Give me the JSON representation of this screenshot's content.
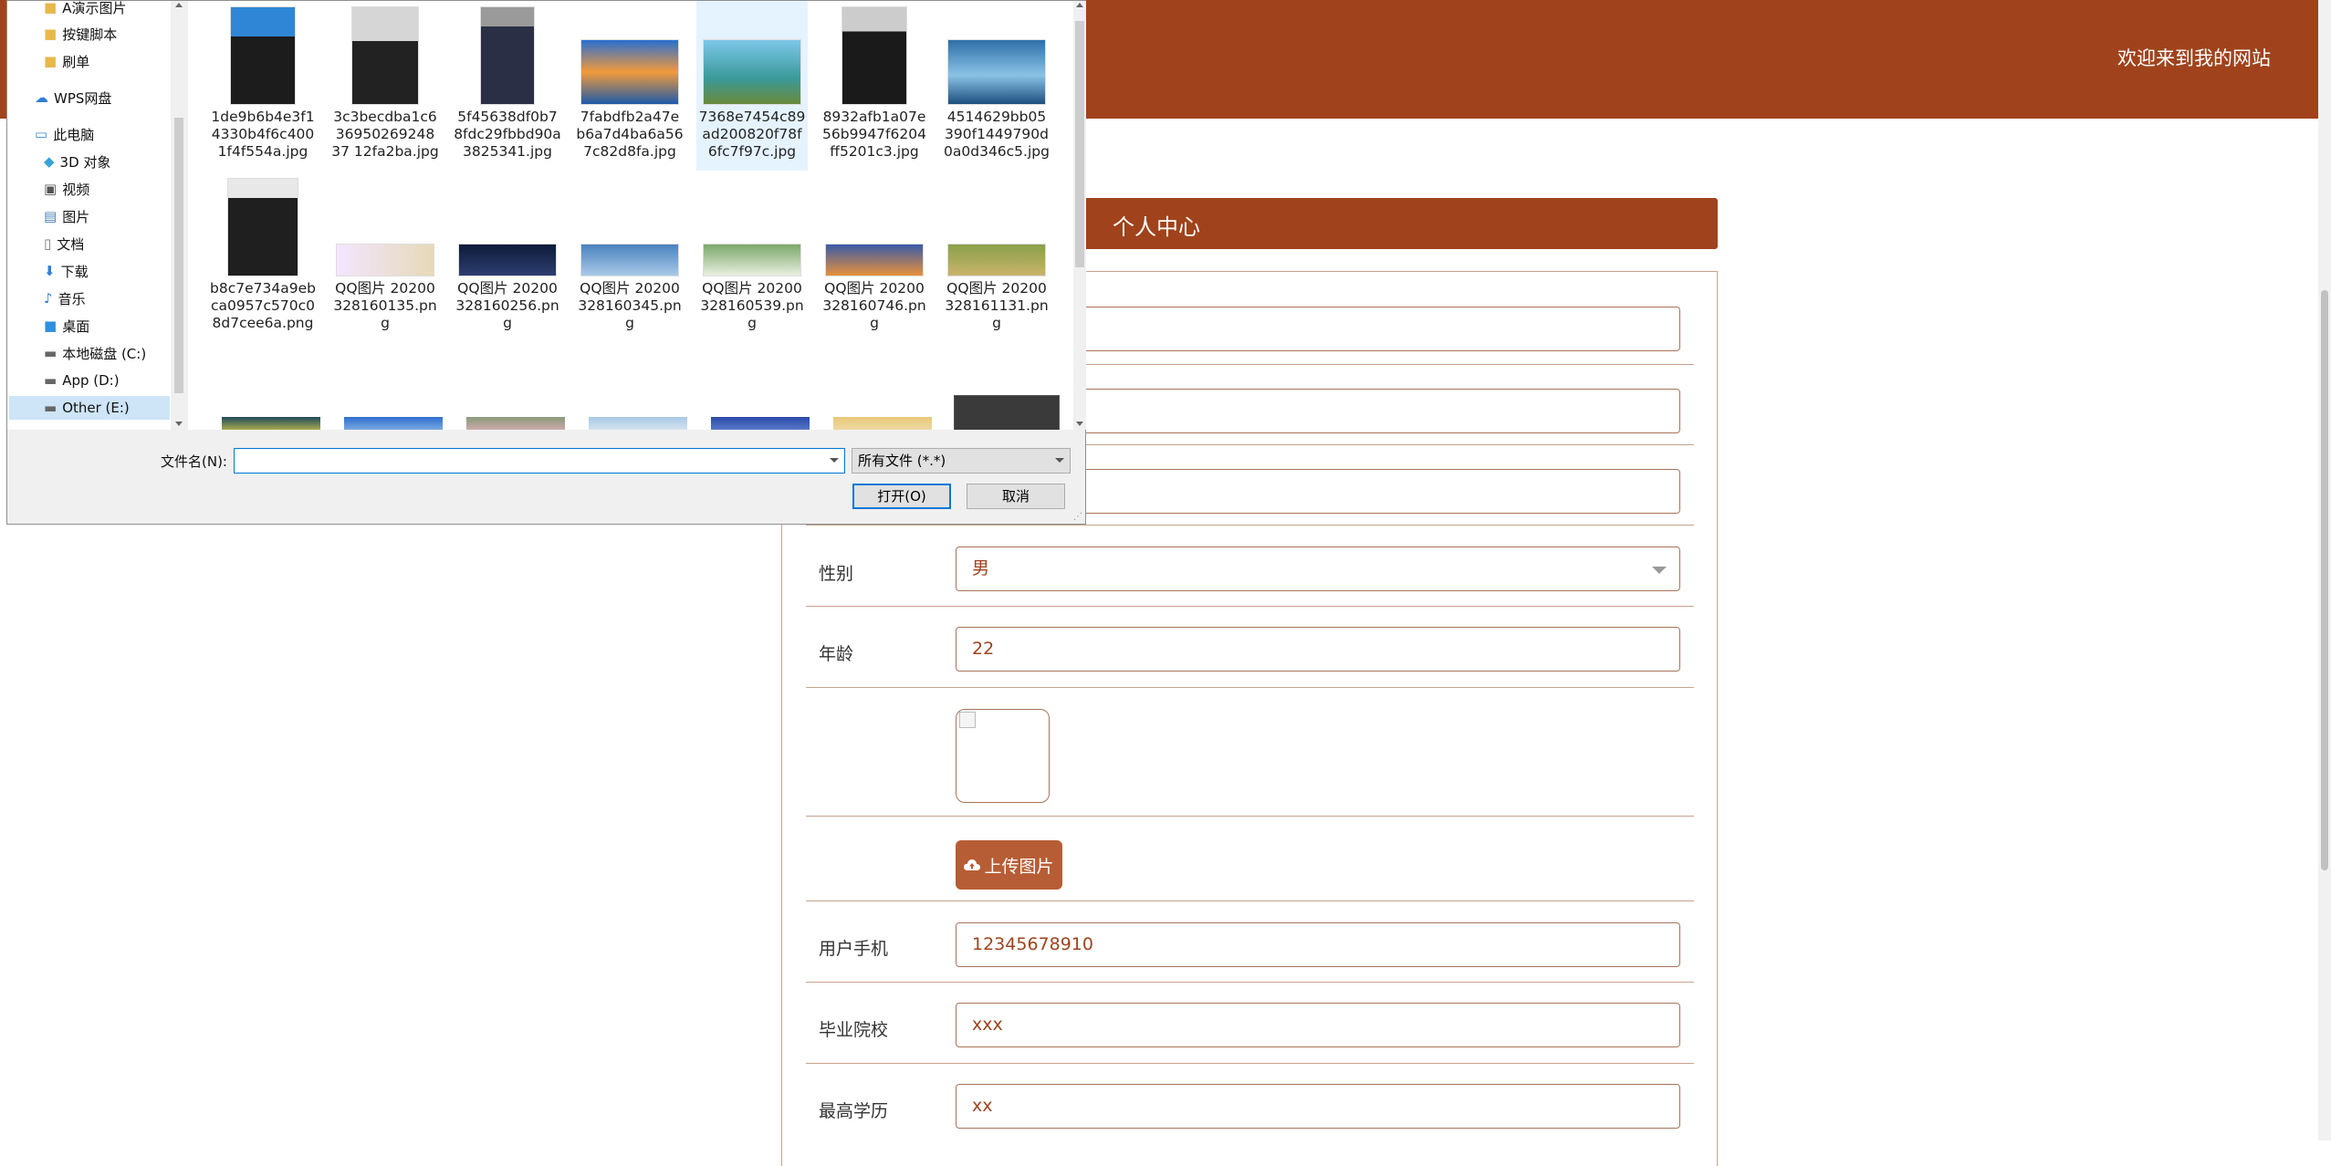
{
  "site": {
    "welcome": "欢迎来到我的网站",
    "tab_label": "个人中心",
    "accent_color": "#a0431c"
  },
  "form": {
    "gender": {
      "label": "性别",
      "value": "男"
    },
    "age": {
      "label": "年龄",
      "value": "22"
    },
    "upload_label": "上传图片",
    "phone": {
      "label": "用户手机",
      "value": "12345678910"
    },
    "school": {
      "label": "毕业院校",
      "value": "xxx"
    },
    "education": {
      "label": "最高学历",
      "value": "xx"
    }
  },
  "dialog": {
    "nav_items": [
      {
        "label": "A演示图片",
        "icon": "folder-icon"
      },
      {
        "label": "按键脚本",
        "icon": "folder-icon"
      },
      {
        "label": "刷单",
        "icon": "folder-icon"
      },
      {
        "label": "WPS网盘",
        "icon": "cloud-icon"
      },
      {
        "label": "此电脑",
        "icon": "computer-icon"
      },
      {
        "label": "3D 对象",
        "icon": "cube-icon"
      },
      {
        "label": "视频",
        "icon": "video-icon"
      },
      {
        "label": "图片",
        "icon": "picture-icon"
      },
      {
        "label": "文档",
        "icon": "document-icon"
      },
      {
        "label": "下载",
        "icon": "download-icon"
      },
      {
        "label": "音乐",
        "icon": "music-icon"
      },
      {
        "label": "桌面",
        "icon": "desktop-icon"
      },
      {
        "label": "本地磁盘 (C:)",
        "icon": "drive-icon"
      },
      {
        "label": "App (D:)",
        "icon": "drive-icon"
      },
      {
        "label": "Other (E:)",
        "icon": "drive-icon"
      }
    ],
    "files_row1": [
      "1de9b6b4e3f14330b4f6c4001f4f554a.jpg",
      "3c3becdba1c63695026924837 12fa2ba.jpg",
      "5f45638df0b78fdc29fbbd90a3825341.jpg",
      "7fabdfb2a47eb6a7d4ba6a567c82d8fa.jpg",
      "7368e7454c89ad200820f78f6fc7f97c.jpg",
      "8932afb1a07e56b9947f6204ff5201c3.jpg",
      "4514629bb05390f1449790d0a0d346c5.jpg"
    ],
    "files_row2": [
      "b8c7e734a9ebca0957c570c08d7cee6a.png",
      "QQ图片 20200328160135.png",
      "QQ图片 20200328160256.png",
      "QQ图片 20200328160345.png",
      "QQ图片 20200328160539.png",
      "QQ图片 20200328160746.png",
      "QQ图片 20200328161131.png"
    ],
    "filename_label": "文件名(N):",
    "filename_value": "",
    "filter_label": "所有文件 (*.*)",
    "open_label": "打开(O)",
    "cancel_label": "取消"
  }
}
